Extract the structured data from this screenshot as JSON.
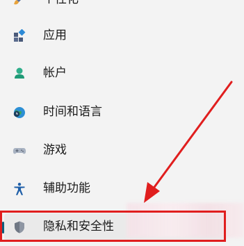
{
  "sidebar": {
    "items": [
      {
        "label": "个性化",
        "icon": "paintbrush-icon",
        "selected": false
      },
      {
        "label": "应用",
        "icon": "apps-icon",
        "selected": false
      },
      {
        "label": "帐户",
        "icon": "person-icon",
        "selected": false
      },
      {
        "label": "时间和语言",
        "icon": "globe-clock-icon",
        "selected": false
      },
      {
        "label": "游戏",
        "icon": "gamepad-icon",
        "selected": false
      },
      {
        "label": "辅助功能",
        "icon": "accessibility-icon",
        "selected": false
      },
      {
        "label": "隐私和安全性",
        "icon": "shield-icon",
        "selected": true
      }
    ]
  },
  "annotation": {
    "highlight_color": "#e01e1e",
    "arrow_color": "#e01e1e"
  },
  "colors": {
    "accent": "#0b5f7d",
    "text": "#1b1b1b",
    "background": "#f3f3f3"
  }
}
